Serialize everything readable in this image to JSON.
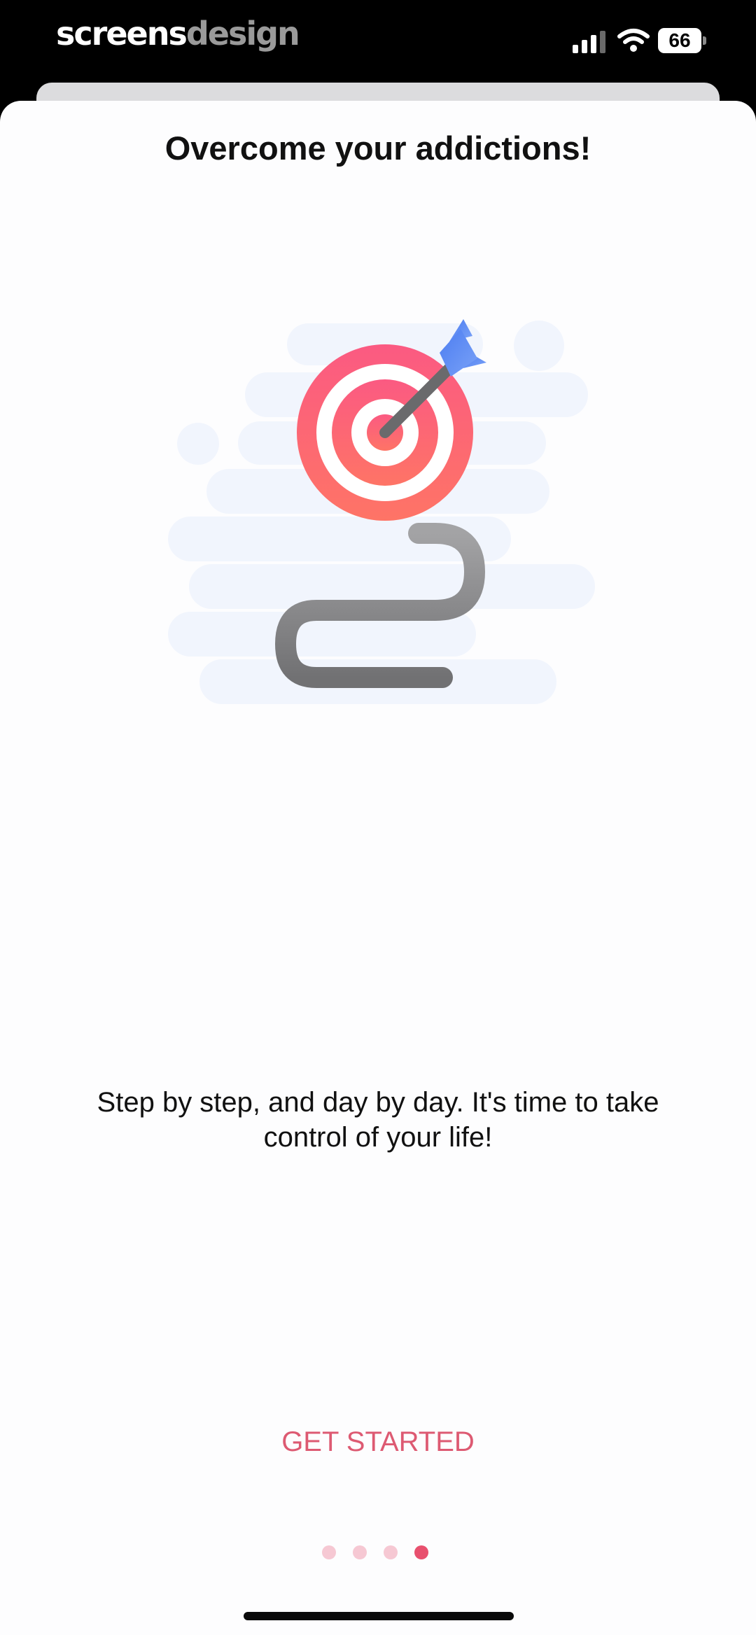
{
  "status_bar": {
    "brand_primary": "screens",
    "brand_secondary": "design",
    "battery_level": "66",
    "signal_icon": "cellular-signal-icon",
    "wifi_icon": "wifi-icon"
  },
  "onboarding": {
    "title": "Overcome your addictions!",
    "illustration_icon": "target-with-arrow-and-winding-path-illustration",
    "description": "Step by step, and day by day. It's time to take control of your life!",
    "cta_label": "GET STARTED",
    "pagination": {
      "total_pages": 4,
      "current_page": 4
    }
  },
  "colors": {
    "accent": "#dd5a72",
    "dot_active": "#e8506e",
    "dot_inactive": "#f6c8d3",
    "background": "#fdfdfe"
  }
}
